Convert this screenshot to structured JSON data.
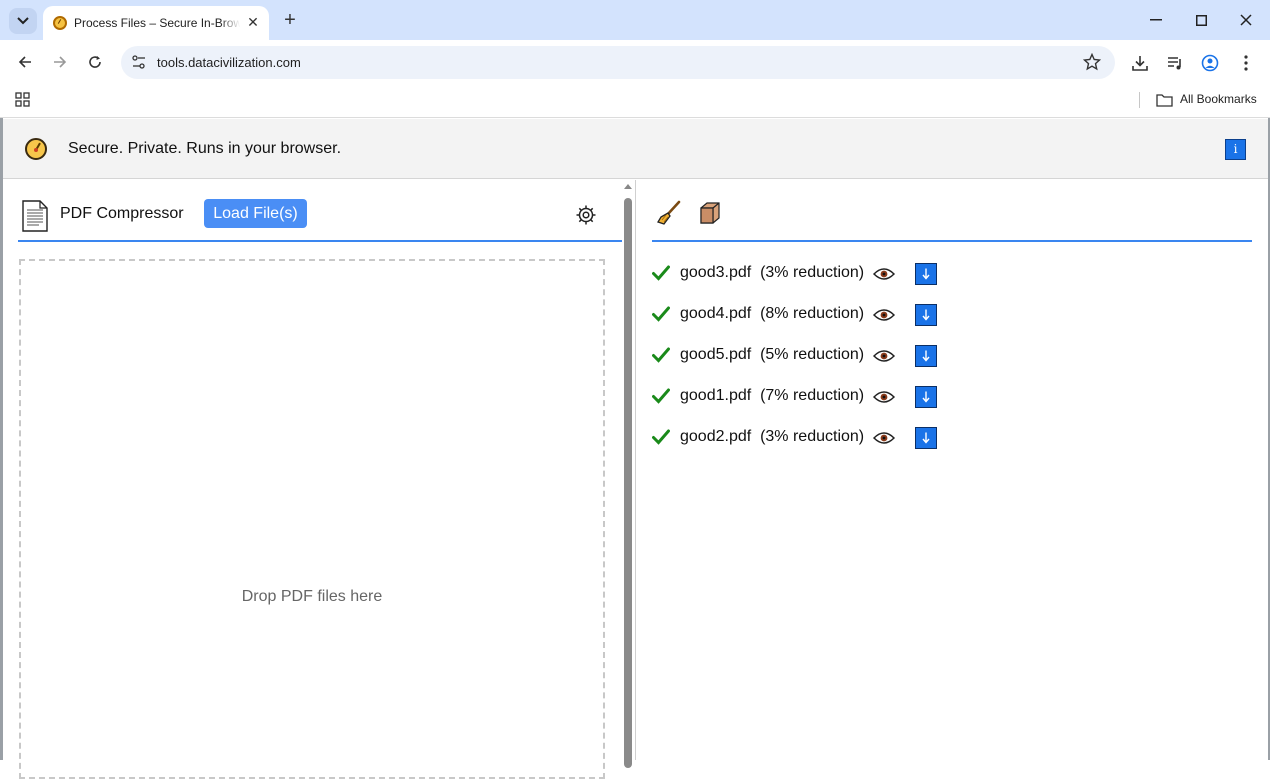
{
  "browser": {
    "tab_title": "Process Files – Secure In-Browser",
    "close_glyph": "✕",
    "new_tab_glyph": "+",
    "url": "tools.datacivilization.com",
    "bookmarks_label": "All Bookmarks",
    "window_controls": {
      "minimize": "—",
      "maximize": "☐",
      "close": "✕"
    }
  },
  "banner": {
    "text": "Secure. Private. Runs in your browser.",
    "info_label": "i"
  },
  "left": {
    "title": "PDF Compressor",
    "load_button": "Load File(s)",
    "drop_text": "Drop PDF files here"
  },
  "files": [
    {
      "name": "good3.pdf",
      "status": "(3% reduction)"
    },
    {
      "name": "good4.pdf",
      "status": "(8% reduction)"
    },
    {
      "name": "good5.pdf",
      "status": "(5% reduction)"
    },
    {
      "name": "good1.pdf",
      "status": "(7% reduction)"
    },
    {
      "name": "good2.pdf",
      "status": "(3% reduction)"
    }
  ],
  "colors": {
    "accent": "#1a73e8",
    "load_button": "#4a8ef5",
    "rule": "#3a86f0",
    "check": "#1a8a1a"
  },
  "icons": {
    "banner": "compass-icon",
    "document": "document-icon",
    "settings": "gear-icon",
    "clear": "broom-icon",
    "archive": "box-icon",
    "success": "checkmark-icon",
    "preview": "eye-icon",
    "download": "download-arrow-icon"
  }
}
